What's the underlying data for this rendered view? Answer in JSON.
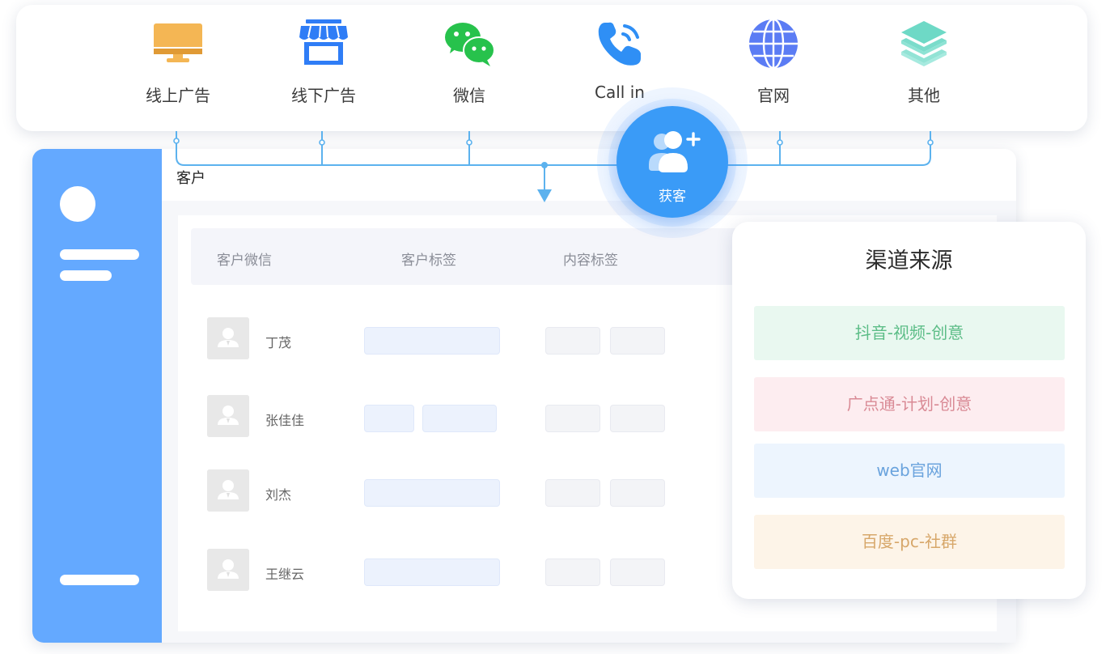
{
  "channels": [
    {
      "label": "线上广告",
      "icon": "monitor-icon"
    },
    {
      "label": "线下广告",
      "icon": "storefront-icon"
    },
    {
      "label": "微信",
      "icon": "wechat-icon"
    },
    {
      "label": "Call in",
      "icon": "phone-icon"
    },
    {
      "label": "官网",
      "icon": "globe-icon"
    },
    {
      "label": "其他",
      "icon": "layers-icon"
    }
  ],
  "app": {
    "title": "客户",
    "columns": [
      "客户微信",
      "客户标签",
      "内容标签"
    ],
    "customers": [
      {
        "name": "丁茂"
      },
      {
        "name": "张佳佳"
      },
      {
        "name": "刘杰"
      },
      {
        "name": "王继云"
      }
    ]
  },
  "acquire": {
    "label": "获客",
    "icon": "add-user-icon"
  },
  "source_panel": {
    "title": "渠道来源",
    "items": [
      {
        "label": "抖音-视频-创意",
        "bg": "#e9f8f0",
        "fg": "#5cbd87"
      },
      {
        "label": "广点通-计划-创意",
        "bg": "#fdedf0",
        "fg": "#d98a95"
      },
      {
        "label": "web官网",
        "bg": "#edf5fe",
        "fg": "#6aa3dd"
      },
      {
        "label": "百度-pc-社群",
        "bg": "#fdf4e8",
        "fg": "#d7a76a"
      }
    ]
  },
  "colors": {
    "accent": "#3a9bf7",
    "sidebar": "#64a9ff",
    "connector": "#5cb2ee"
  }
}
